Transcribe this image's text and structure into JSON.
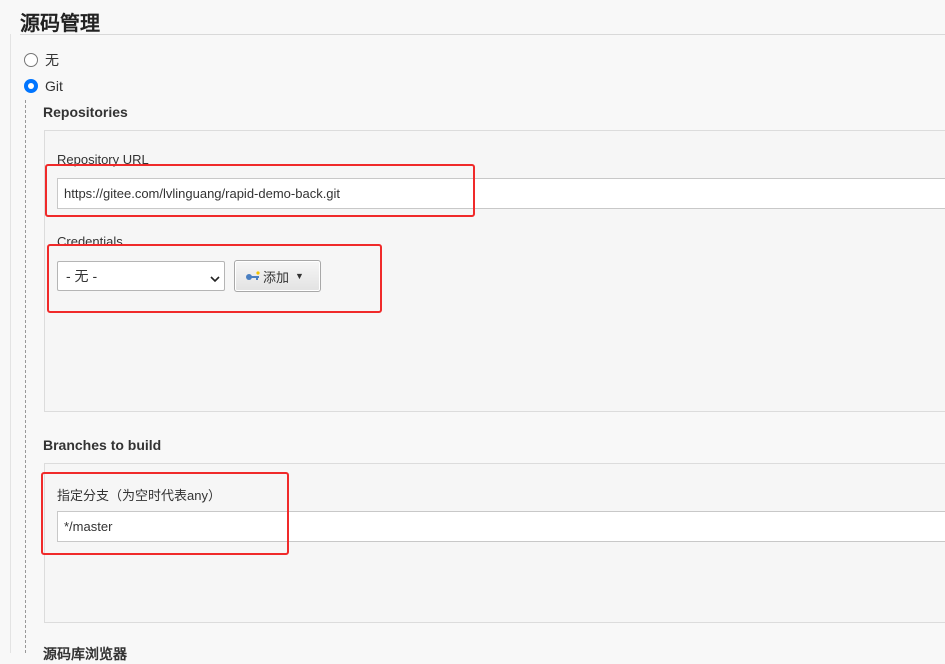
{
  "section": {
    "title": "源码管理"
  },
  "scm_options": [
    {
      "label": "无",
      "checked": false
    },
    {
      "label": "Git",
      "checked": true
    }
  ],
  "repositories": {
    "heading": "Repositories",
    "url_label": "Repository URL",
    "url_value": "https://gitee.com/lvlinguang/rapid-demo-back.git",
    "credentials_label": "Credentials",
    "credentials_selected": "- 无 -",
    "add_button_label": "添加"
  },
  "branches": {
    "heading": "Branches to build",
    "spec_label": "指定分支（为空时代表any）",
    "spec_value": "*/master"
  },
  "next_section_label": "源码库浏览器",
  "colors": {
    "highlight": "#f02a2a",
    "radio_accent": "#0075ff"
  }
}
